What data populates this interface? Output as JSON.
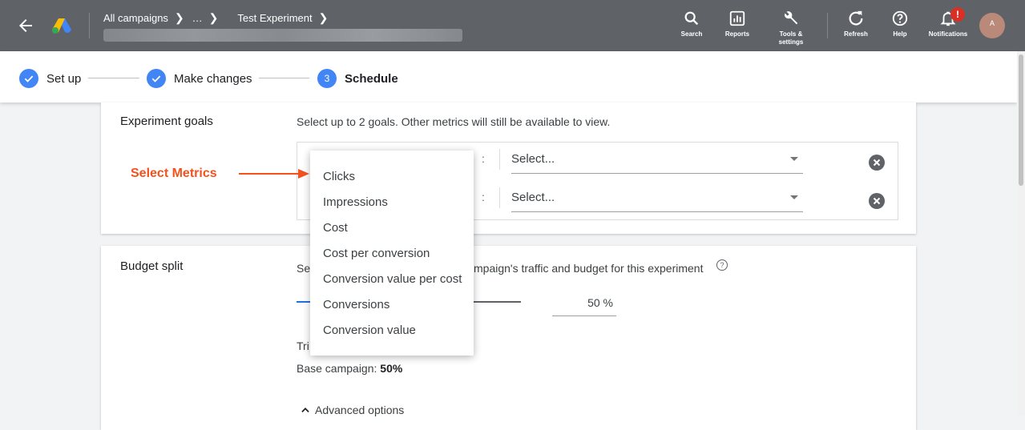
{
  "header": {
    "breadcrumb": [
      "All campaigns",
      "…",
      "Test Experiment"
    ],
    "actions": [
      {
        "id": "search",
        "label": "Search",
        "icon": "search-icon"
      },
      {
        "id": "reports",
        "label": "Reports",
        "icon": "reports-icon"
      },
      {
        "id": "tools",
        "label": "Tools & settings",
        "icon": "wrench-icon"
      },
      {
        "id": "refresh",
        "label": "Refresh",
        "icon": "refresh-icon"
      },
      {
        "id": "help",
        "label": "Help",
        "icon": "help-icon"
      },
      {
        "id": "notifications",
        "label": "Notifications",
        "icon": "bell-icon",
        "badge": "!"
      }
    ],
    "avatar_initial": "A"
  },
  "stepper": {
    "steps": [
      {
        "label": "Set up",
        "state": "done"
      },
      {
        "label": "Make changes",
        "state": "done"
      },
      {
        "label": "Schedule",
        "state": "current",
        "number": "3"
      }
    ]
  },
  "goals": {
    "title": "Experiment goals",
    "description": "Select up to 2 goals. Other metrics will still be available to view.",
    "rows": [
      {
        "colon": ":",
        "select_placeholder": "Select..."
      },
      {
        "colon": ":",
        "select_placeholder": "Select..."
      }
    ]
  },
  "annotation": {
    "label": "Select Metrics"
  },
  "dropdown": {
    "options": [
      "Clicks",
      "Impressions",
      "Cost",
      "Cost per conversion",
      "Conversion value per cost",
      "Conversions",
      "Conversion value"
    ]
  },
  "budget": {
    "title": "Budget split",
    "desc_prefix": "Se",
    "desc_suffix": "mpaign's traffic and budget for this experiment",
    "slider_value_pct": 50,
    "value_text": "50 %",
    "trial_prefix": "Tri",
    "base_label": "Base campaign:",
    "base_value": "50%",
    "advanced_label": "Advanced options"
  },
  "colors": {
    "topbar": "#5f6368",
    "accent_blue": "#4285f4",
    "annotation": "#f4511e",
    "badge": "#d93025"
  }
}
